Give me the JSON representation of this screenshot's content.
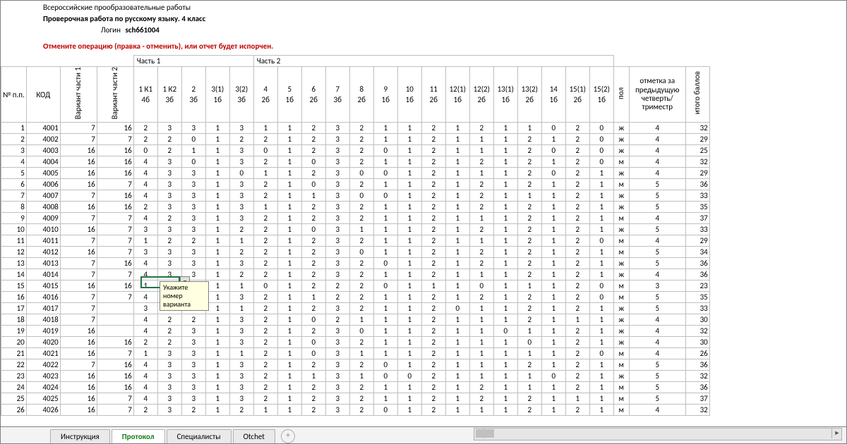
{
  "header": {
    "title_line1": "Всероссийские прообразовательные работы",
    "title_line2": "Проверочная работа по русскому языку. 4 класс",
    "login_label": "Логин",
    "login_value": "sch661004",
    "warning": "Отмените операцию (правка - отменить), или отчет будет испорчен."
  },
  "parts": {
    "p1": "Часть 1",
    "p2": "Часть 2"
  },
  "cols": {
    "num": "№ п.п.",
    "code": "КОД",
    "var1": "Вариант части 1",
    "var2": "Вариант части 2",
    "q": [
      "1 К1\n4б",
      "1 К2\n3б",
      "2\n3б",
      "3(1)\n1б",
      "3(2)\n3б",
      "4\n2б",
      "5\n1б",
      "6\n2б",
      "7\n3б",
      "8\n2б",
      "9\n1б",
      "10\n1б",
      "11\n2б",
      "12(1)\n1б",
      "12(2)\n2б",
      "13(1)\n1б",
      "13(2)\n2б",
      "14\n1б",
      "15(1)\n2б",
      "15(2)\n1б"
    ],
    "sex": "пол",
    "mark": "отметка за предыдущую четверть/ триместр",
    "total": "итого баллов"
  },
  "tooltip": "Укажите номер варианта",
  "rows": [
    {
      "n": 1,
      "c": 4001,
      "v1": 7,
      "v2": 16,
      "a": [
        2,
        3,
        3,
        1,
        3,
        1,
        1,
        2,
        3,
        2,
        1,
        1,
        2,
        1,
        2,
        1,
        1,
        0,
        2,
        0
      ],
      "s": "ж",
      "m": 4,
      "t": 32
    },
    {
      "n": 2,
      "c": 4002,
      "v1": 7,
      "v2": 7,
      "a": [
        2,
        2,
        0,
        1,
        2,
        2,
        1,
        2,
        3,
        2,
        1,
        1,
        2,
        1,
        1,
        1,
        2,
        1,
        2,
        0
      ],
      "s": "ж",
      "m": 4,
      "t": 29
    },
    {
      "n": 3,
      "c": 4003,
      "v1": 16,
      "v2": 16,
      "a": [
        0,
        2,
        1,
        1,
        3,
        0,
        1,
        2,
        3,
        2,
        0,
        1,
        2,
        1,
        1,
        1,
        2,
        0,
        2,
        0
      ],
      "s": "ж",
      "m": 4,
      "t": 25
    },
    {
      "n": 4,
      "c": 4004,
      "v1": 16,
      "v2": 16,
      "a": [
        4,
        3,
        0,
        1,
        3,
        2,
        1,
        0,
        3,
        2,
        1,
        1,
        2,
        1,
        2,
        1,
        2,
        1,
        2,
        0
      ],
      "s": "м",
      "m": 4,
      "t": 32
    },
    {
      "n": 5,
      "c": 4005,
      "v1": 16,
      "v2": 16,
      "a": [
        4,
        3,
        3,
        1,
        0,
        1,
        1,
        2,
        3,
        0,
        0,
        1,
        2,
        1,
        1,
        1,
        2,
        0,
        2,
        1
      ],
      "s": "ж",
      "m": 4,
      "t": 29
    },
    {
      "n": 6,
      "c": 4006,
      "v1": 16,
      "v2": 7,
      "a": [
        4,
        3,
        3,
        1,
        3,
        2,
        1,
        0,
        3,
        2,
        1,
        1,
        2,
        1,
        2,
        1,
        2,
        1,
        2,
        1
      ],
      "s": "м",
      "m": 5,
      "t": 36
    },
    {
      "n": 7,
      "c": 4007,
      "v1": 7,
      "v2": 16,
      "a": [
        4,
        3,
        3,
        1,
        3,
        2,
        1,
        1,
        3,
        0,
        0,
        1,
        2,
        1,
        2,
        1,
        1,
        1,
        2,
        1
      ],
      "s": "ж",
      "m": 5,
      "t": 33
    },
    {
      "n": 8,
      "c": 4008,
      "v1": 16,
      "v2": 16,
      "a": [
        2,
        3,
        3,
        1,
        3,
        1,
        1,
        2,
        3,
        2,
        1,
        1,
        2,
        1,
        2,
        1,
        2,
        1,
        2,
        1
      ],
      "s": "ж",
      "m": 5,
      "t": 35
    },
    {
      "n": 9,
      "c": 4009,
      "v1": 7,
      "v2": 7,
      "a": [
        4,
        2,
        3,
        1,
        3,
        2,
        1,
        2,
        3,
        2,
        1,
        1,
        2,
        1,
        1,
        1,
        2,
        1,
        2,
        1
      ],
      "s": "м",
      "m": 4,
      "t": 37
    },
    {
      "n": 10,
      "c": 4010,
      "v1": 16,
      "v2": 7,
      "a": [
        3,
        3,
        3,
        1,
        2,
        2,
        1,
        0,
        3,
        1,
        1,
        1,
        2,
        1,
        2,
        1,
        2,
        1,
        2,
        1
      ],
      "s": "ж",
      "m": 5,
      "t": 33
    },
    {
      "n": 11,
      "c": 4011,
      "v1": 7,
      "v2": 7,
      "a": [
        1,
        2,
        2,
        1,
        1,
        2,
        1,
        2,
        3,
        2,
        1,
        1,
        2,
        1,
        1,
        1,
        2,
        1,
        2,
        0
      ],
      "s": "м",
      "m": 4,
      "t": 29
    },
    {
      "n": 12,
      "c": 4012,
      "v1": 16,
      "v2": 7,
      "a": [
        3,
        3,
        3,
        1,
        2,
        2,
        1,
        2,
        3,
        0,
        1,
        1,
        2,
        1,
        2,
        1,
        2,
        1,
        2,
        1
      ],
      "s": "м",
      "m": 5,
      "t": 34
    },
    {
      "n": 13,
      "c": 4013,
      "v1": 7,
      "v2": 16,
      "a": [
        4,
        3,
        3,
        1,
        3,
        2,
        1,
        2,
        3,
        2,
        0,
        1,
        2,
        1,
        2,
        1,
        2,
        1,
        2,
        1
      ],
      "s": "ж",
      "m": 5,
      "t": 36
    },
    {
      "n": 14,
      "c": 4014,
      "v1": 7,
      "v2": 7,
      "a": [
        4,
        3,
        3,
        1,
        2,
        2,
        1,
        2,
        3,
        2,
        1,
        1,
        2,
        1,
        1,
        1,
        2,
        1,
        2,
        1
      ],
      "s": "ж",
      "m": 4,
      "t": 36
    },
    {
      "n": 15,
      "c": 4015,
      "v1": 16,
      "v2": 16,
      "a": [
        1,
        3,
        3,
        1,
        1,
        0,
        1,
        2,
        2,
        2,
        0,
        1,
        1,
        1,
        0,
        1,
        1,
        1,
        2,
        0
      ],
      "s": "м",
      "m": 3,
      "t": 23
    },
    {
      "n": 16,
      "c": 4016,
      "v1": 7,
      "v2": 7,
      "a": [
        4,
        3,
        3,
        1,
        3,
        2,
        1,
        1,
        2,
        2,
        1,
        1,
        2,
        1,
        2,
        1,
        2,
        1,
        2,
        0
      ],
      "s": "м",
      "m": 5,
      "t": 35
    },
    {
      "n": 17,
      "c": 4017,
      "v1": 7,
      "v2": "",
      "a": [
        3,
        2,
        3,
        1,
        1,
        2,
        1,
        2,
        3,
        2,
        1,
        1,
        2,
        0,
        1,
        1,
        2,
        1,
        2,
        1
      ],
      "s": "ж",
      "m": 5,
      "t": 33
    },
    {
      "n": 18,
      "c": 4018,
      "v1": 7,
      "v2": "",
      "a": [
        4,
        2,
        2,
        1,
        3,
        2,
        1,
        0,
        2,
        1,
        1,
        1,
        2,
        1,
        1,
        1,
        2,
        1,
        1,
        1
      ],
      "s": "ж",
      "m": 4,
      "t": 30
    },
    {
      "n": 19,
      "c": 4019,
      "v1": 16,
      "v2": "",
      "a": [
        4,
        2,
        3,
        1,
        3,
        2,
        1,
        2,
        3,
        0,
        1,
        1,
        2,
        1,
        1,
        0,
        1,
        1,
        2,
        1
      ],
      "s": "ж",
      "m": 4,
      "t": 32
    },
    {
      "n": 20,
      "c": 4020,
      "v1": 16,
      "v2": 16,
      "a": [
        2,
        2,
        3,
        1,
        3,
        2,
        1,
        0,
        3,
        2,
        1,
        1,
        2,
        1,
        1,
        1,
        0,
        1,
        2,
        1
      ],
      "s": "ж",
      "m": 4,
      "t": 30
    },
    {
      "n": 21,
      "c": 4021,
      "v1": 16,
      "v2": 7,
      "a": [
        1,
        3,
        3,
        1,
        1,
        2,
        1,
        0,
        3,
        1,
        1,
        1,
        2,
        1,
        1,
        1,
        1,
        1,
        2,
        0
      ],
      "s": "м",
      "m": 4,
      "t": 26
    },
    {
      "n": 22,
      "c": 4022,
      "v1": 7,
      "v2": 16,
      "a": [
        4,
        3,
        3,
        1,
        3,
        2,
        1,
        2,
        3,
        2,
        0,
        1,
        2,
        1,
        1,
        1,
        2,
        1,
        2,
        1
      ],
      "s": "м",
      "m": 5,
      "t": 36
    },
    {
      "n": 23,
      "c": 4023,
      "v1": 16,
      "v2": 16,
      "a": [
        4,
        3,
        3,
        1,
        3,
        2,
        1,
        1,
        3,
        1,
        0,
        0,
        2,
        1,
        1,
        1,
        1,
        0,
        2,
        1
      ],
      "s": "ж",
      "m": 5,
      "t": 32
    },
    {
      "n": 24,
      "c": 4024,
      "v1": 16,
      "v2": 16,
      "a": [
        4,
        3,
        3,
        1,
        3,
        2,
        1,
        2,
        3,
        2,
        1,
        1,
        2,
        1,
        2,
        1,
        1,
        1,
        2,
        1
      ],
      "s": "м",
      "m": 5,
      "t": 36
    },
    {
      "n": 25,
      "c": 4025,
      "v1": 16,
      "v2": 7,
      "a": [
        4,
        3,
        3,
        1,
        3,
        2,
        1,
        2,
        3,
        2,
        1,
        1,
        2,
        1,
        2,
        1,
        2,
        1,
        1,
        1
      ],
      "s": "м",
      "m": 5,
      "t": 37
    },
    {
      "n": 26,
      "c": 4026,
      "v1": 16,
      "v2": 7,
      "a": [
        2,
        3,
        2,
        1,
        2,
        1,
        1,
        2,
        3,
        2,
        0,
        1,
        2,
        1,
        1,
        1,
        2,
        1,
        2,
        1
      ],
      "s": "м",
      "m": 4,
      "t": 32
    }
  ],
  "tabs": {
    "t1": "Инструкция",
    "t2": "Протокол",
    "t3": "Специалисты",
    "t4": "Otchet",
    "add": "+"
  }
}
